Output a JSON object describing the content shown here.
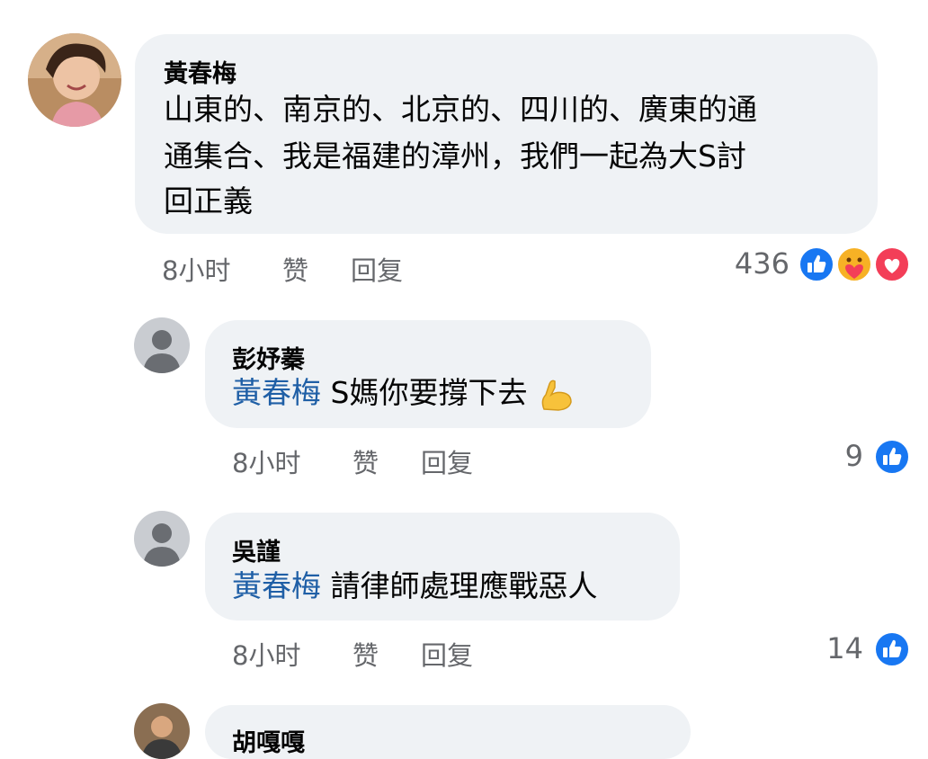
{
  "comments": [
    {
      "author": "黃春梅",
      "lines": [
        "山東的、南京的、北京的、四川的、廣東的通",
        "通集合、我是福建的漳州，我們一起為大S討",
        "回正義"
      ],
      "time": "8小时",
      "like_label": "赞",
      "reply_label": "回复",
      "reaction_count": "436",
      "reactions": [
        "like-icon",
        "care-icon",
        "love-icon"
      ]
    },
    {
      "author": "彭妤蓁",
      "mention": "黃春梅",
      "text": "S媽你要撐下去",
      "emoji": "flexed-biceps-emoji",
      "time": "8小时",
      "like_label": "赞",
      "reply_label": "回复",
      "reaction_count": "9",
      "reactions": [
        "like-icon"
      ]
    },
    {
      "author": "吳謹",
      "mention": "黃春梅",
      "text": "請律師處理應戰惡人",
      "time": "8小时",
      "like_label": "赞",
      "reply_label": "回复",
      "reaction_count": "14",
      "reactions": [
        "like-icon"
      ]
    },
    {
      "author": "胡嘎嘎"
    }
  ],
  "colors": {
    "bubble_bg": "#eff2f5",
    "mention": "#1f5fa6",
    "meta": "#65676b",
    "like_blue": "#1877f2",
    "love_red": "#f33e58"
  }
}
